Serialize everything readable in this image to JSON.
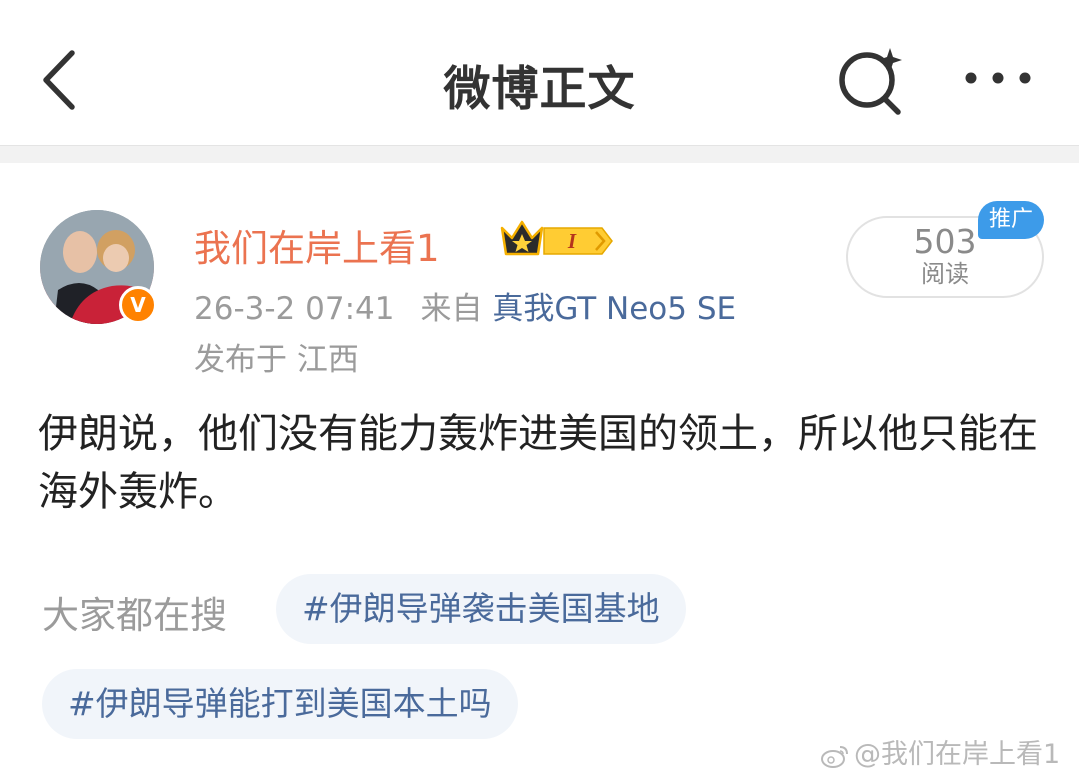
{
  "header": {
    "title": "微博正文",
    "back_icon": "chevron-left-icon",
    "search_icon": "search-sparkle-icon",
    "more_icon": "more-dots-icon"
  },
  "post": {
    "author": {
      "name": "我们在岸上看1",
      "verified_mark": "V",
      "member_level": "I"
    },
    "timestamp": "26-3-2 07:41",
    "source_prefix": "来自",
    "source_device": "真我GT Neo5 SE",
    "location": "发布于 江西",
    "read_count": "503",
    "read_label": "阅读",
    "promo_label": "推广",
    "text": "伊朗说，他们没有能力轰炸进美国的领土，所以他只能在海外轰炸。"
  },
  "trending": {
    "label": "大家都在搜",
    "tags": [
      "#伊朗导弹袭击美国基地",
      "#伊朗导弹能打到美国本土吗"
    ]
  },
  "watermark": "@我们在岸上看1",
  "colors": {
    "username": "#eb7350",
    "link": "#4a6a9b",
    "verified": "#ff8200",
    "promo": "#3d9be9"
  }
}
